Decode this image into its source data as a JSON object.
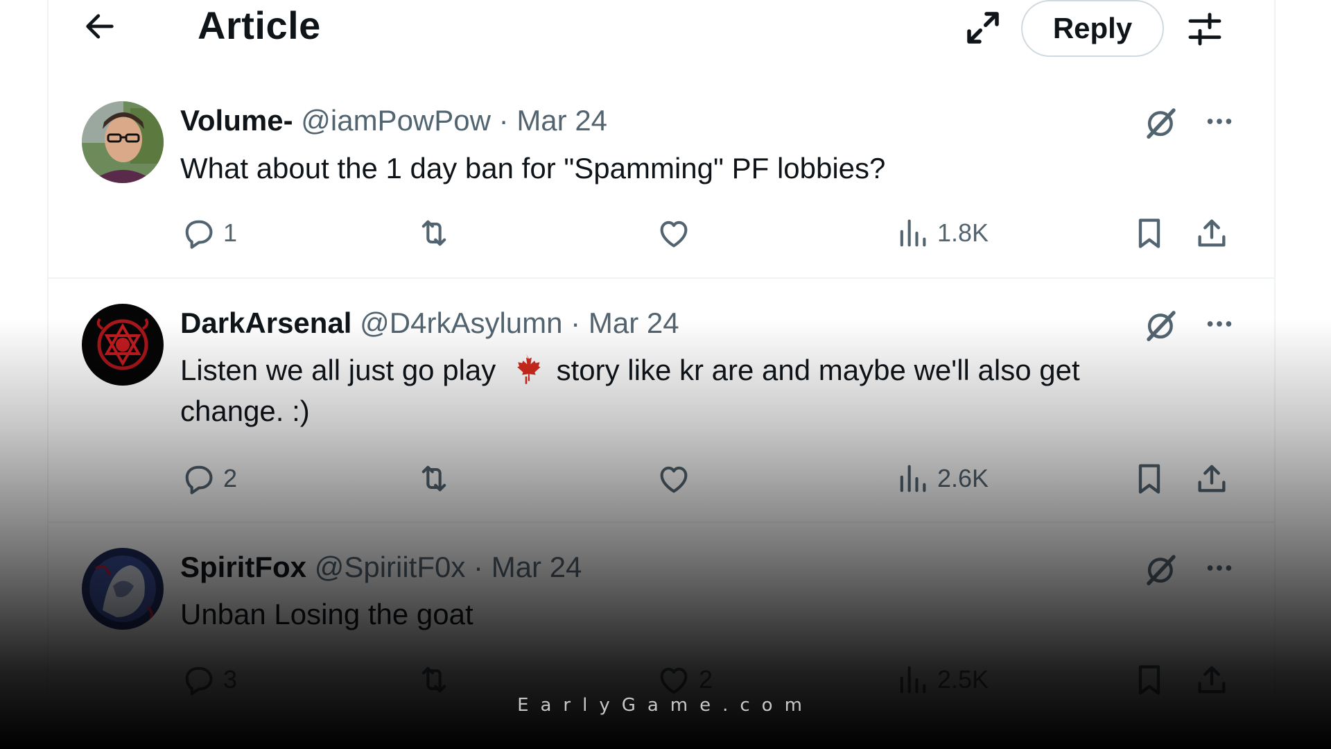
{
  "header": {
    "title": "Article",
    "reply_label": "Reply"
  },
  "posts": [
    {
      "name": "Volume-",
      "handle": "@iamPowPow",
      "dot": "·",
      "date": "Mar 24",
      "text": "What about the 1 day ban for \"Spamming\" PF lobbies?",
      "replies": "1",
      "reposts": "",
      "likes": "",
      "views": "1.8K"
    },
    {
      "name": "DarkArsenal",
      "handle": "@D4rkAsylumn",
      "dot": "·",
      "date": "Mar 24",
      "text_before": "Listen we all just go play",
      "text_after": "story like kr are and maybe we'll also get change. :)",
      "emoji_icon": "maple-leaf-icon",
      "replies": "2",
      "reposts": "",
      "likes": "",
      "views": "2.6K"
    },
    {
      "name": "SpiritFox",
      "handle": "@SpiriitF0x",
      "dot": "·",
      "date": "Mar 24",
      "text": "Unban Losing the goat",
      "replies": "3",
      "reposts": "",
      "likes": "2",
      "views": "2.5K"
    }
  ],
  "watermark": "EarlyGame.com",
  "colors": {
    "text": "#0f1419",
    "muted": "#536471",
    "border": "#eff3f4",
    "maple": "#d52b1e"
  }
}
